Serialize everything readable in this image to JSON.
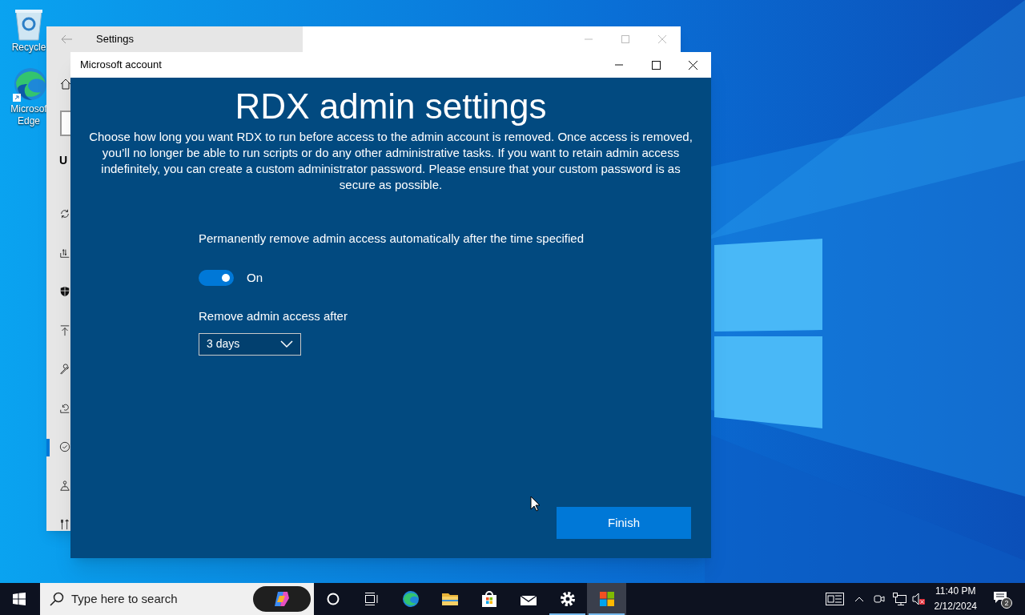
{
  "desktop": {
    "icons": [
      {
        "lines": [
          "Recycle"
        ]
      },
      {
        "lines": [
          "Microsof",
          "Edge"
        ]
      }
    ]
  },
  "settings_window": {
    "title": "Settings",
    "heading": "U",
    "nav_items": [
      {
        "selected": false
      },
      {
        "selected": false
      },
      {
        "selected": false
      },
      {
        "selected": false
      },
      {
        "selected": false
      },
      {
        "selected": false
      },
      {
        "selected": true
      },
      {
        "selected": false
      },
      {
        "selected": false
      }
    ]
  },
  "dialog": {
    "title": "Microsoft account",
    "heading": "RDX admin settings",
    "description": "Choose how long you want RDX to run before access to the admin account is removed. Once access is removed, you’ll no longer be able to run scripts or do any other administrative tasks. If you want to retain admin access indefinitely, you can create a custom administrator password. Please ensure that your custom password is as secure as possible.",
    "toggle": {
      "label": "Permanently remove admin access automatically after the time specified",
      "on": true,
      "state_text": "On"
    },
    "dropdown": {
      "label": "Remove admin access after",
      "value": "3 days"
    },
    "button": "Finish"
  },
  "taskbar": {
    "search_placeholder": "Type here to search",
    "apps": [
      {
        "running": false,
        "selected": false
      },
      {
        "running": false,
        "selected": false
      },
      {
        "running": false,
        "selected": false
      },
      {
        "running": false,
        "selected": false
      },
      {
        "running": true,
        "selected": false
      },
      {
        "running": true,
        "selected": true
      }
    ],
    "clock": {
      "time": "11:40 PM",
      "date": "2/12/2024"
    },
    "notification_count": "2"
  }
}
